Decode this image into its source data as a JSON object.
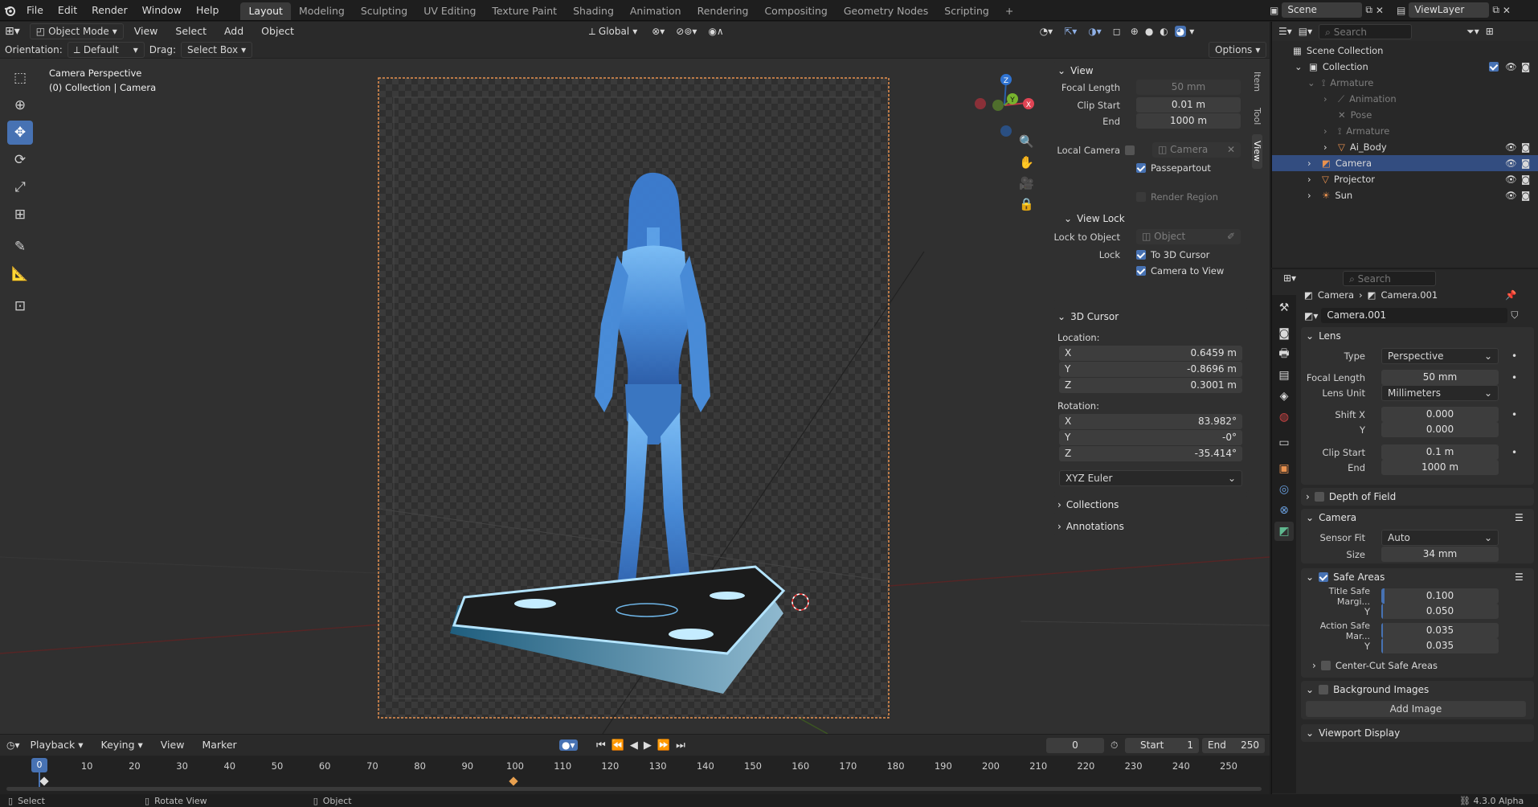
{
  "topbar": {
    "menus": [
      "File",
      "Edit",
      "Render",
      "Window",
      "Help"
    ],
    "workspaces": [
      "Layout",
      "Modeling",
      "Sculpting",
      "UV Editing",
      "Texture Paint",
      "Shading",
      "Animation",
      "Rendering",
      "Compositing",
      "Geometry Nodes",
      "Scripting"
    ],
    "active_workspace": "Layout",
    "add_tab": "+",
    "scene": "Scene",
    "view_layer": "ViewLayer"
  },
  "header": {
    "mode": "Object Mode",
    "menus": [
      "View",
      "Select",
      "Add",
      "Object"
    ],
    "transform_orientation": "Global",
    "options": "Options",
    "orientation_label": "Orientation:",
    "orientation_value": "Default",
    "drag_label": "Drag:",
    "drag_value": "Select Box"
  },
  "viewport": {
    "title": "Camera Perspective",
    "subtitle": "(0) Collection | Camera"
  },
  "gizmo": {
    "z": "Z",
    "y": "Y",
    "x": "X"
  },
  "npanel": {
    "tabs": [
      "Item",
      "Tool",
      "View"
    ],
    "view": {
      "title": "View",
      "focal_length_label": "Focal Length",
      "focal_length": "50 mm",
      "clip_start_label": "Clip Start",
      "clip_start": "0.01 m",
      "end_label": "End",
      "end": "1000 m",
      "local_camera_label": "Local Camera",
      "local_camera": "Camera",
      "passepartout": "Passepartout",
      "render_region": "Render Region"
    },
    "view_lock": {
      "title": "View Lock",
      "lock_to_object_label": "Lock to Object",
      "lock_to_object_placeholder": "Object",
      "lock_label": "Lock",
      "to_3d_cursor": "To 3D Cursor",
      "camera_to_view": "Camera to View"
    },
    "cursor": {
      "title": "3D Cursor",
      "location_label": "Location:",
      "loc_x": "0.6459 m",
      "loc_y": "-0.8696 m",
      "loc_z": "0.3001 m",
      "rotation_label": "Rotation:",
      "rot_x": "83.982°",
      "rot_y": "-0°",
      "rot_z": "-35.414°",
      "mode": "XYZ Euler",
      "axis_x": "X",
      "axis_y": "Y",
      "axis_z": "Z"
    },
    "collections": "Collections",
    "annotations": "Annotations"
  },
  "timeline": {
    "menus": [
      "Playback",
      "Keying",
      "View",
      "Marker"
    ],
    "current_frame": "0",
    "start_label": "Start",
    "start": "1",
    "end_label": "End",
    "end": "250",
    "ticks": [
      "0",
      "10",
      "20",
      "30",
      "40",
      "50",
      "60",
      "70",
      "80",
      "90",
      "100",
      "110",
      "120",
      "130",
      "140",
      "150",
      "160",
      "170",
      "180",
      "190",
      "200",
      "210",
      "220",
      "230",
      "240",
      "250"
    ]
  },
  "statusbar": {
    "select": "Select",
    "rotate_view": "Rotate View",
    "object": "Object",
    "version": "4.3.0 Alpha"
  },
  "outliner": {
    "search_placeholder": "Search",
    "scene_collection": "Scene Collection",
    "items": [
      {
        "label": "Collection",
        "depth": 1
      },
      {
        "label": "Armature",
        "depth": 2,
        "dim": true
      },
      {
        "label": "Animation",
        "depth": 3,
        "dim": true
      },
      {
        "label": "Pose",
        "depth": 3,
        "dim": true
      },
      {
        "label": "Armature",
        "depth": 3,
        "dim": true
      },
      {
        "label": "Ai_Body",
        "depth": 3
      },
      {
        "label": "Camera",
        "depth": 2,
        "selected": true
      },
      {
        "label": "Projector",
        "depth": 2
      },
      {
        "label": "Sun",
        "depth": 2
      }
    ]
  },
  "properties": {
    "search_placeholder": "Search",
    "breadcrumb_object": "Camera",
    "breadcrumb_data": "Camera.001",
    "datablock": "Camera.001",
    "lens": {
      "title": "Lens",
      "type_label": "Type",
      "type": "Perspective",
      "focal_label": "Focal Length",
      "focal": "50 mm",
      "unit_label": "Lens Unit",
      "unit": "Millimeters",
      "shift_x_label": "Shift X",
      "shift_x": "0.000",
      "shift_y_label": "Y",
      "shift_y": "0.000",
      "clip_start_label": "Clip Start",
      "clip_start": "0.1 m",
      "clip_end_label": "End",
      "clip_end": "1000 m"
    },
    "dof": "Depth of Field",
    "camera": {
      "title": "Camera",
      "sensor_fit_label": "Sensor Fit",
      "sensor_fit": "Auto",
      "size_label": "Size",
      "size": "34 mm"
    },
    "safe_areas": {
      "title": "Safe Areas",
      "title_safe_label": "Title Safe Margi...",
      "title_safe": "0.100",
      "title_y_label": "Y",
      "title_y": "0.050",
      "action_safe_label": "Action Safe Mar...",
      "action_safe": "0.035",
      "action_y_label": "Y",
      "action_y": "0.035",
      "center_cut": "Center-Cut Safe Areas"
    },
    "background_images": "Background Images",
    "add_image": "Add Image",
    "viewport_display": "Viewport Display"
  },
  "colors": {
    "accent": "#4772b3",
    "selected_row": "#334d80",
    "camera_frame": "#e8914f"
  }
}
